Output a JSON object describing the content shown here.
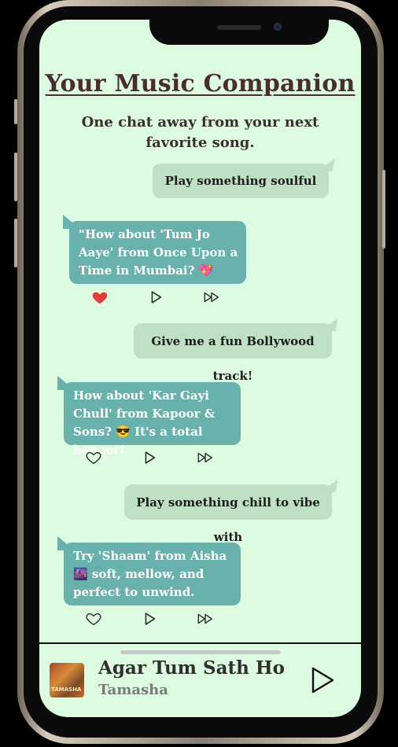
{
  "app": {
    "title": "Your Music Companion",
    "subtitle": "One chat away from your next favorite song."
  },
  "messages": [
    {
      "role": "user",
      "text": "Play something soulful"
    },
    {
      "role": "bot",
      "text": "\"How about 'Tum Jo Aaye' from Once Upon a Time in Mumbai? 💖",
      "liked": true
    },
    {
      "role": "user",
      "text": "Give me a fun Bollywood track!"
    },
    {
      "role": "bot",
      "text": "How about 'Kar Gayi Chull' from Kapoor & Sons? 😎 It's a total banger!",
      "liked": false
    },
    {
      "role": "user",
      "text": "Play something chill to vibe with"
    },
    {
      "role": "bot",
      "text": "Try 'Shaam' from Aisha 🌆 soft, mellow, and perfect to unwind.",
      "liked": false
    }
  ],
  "now_playing": {
    "title": "Agar Tum Sath Ho",
    "artist": "Tamasha"
  },
  "icons": {
    "like": "heart-icon",
    "play": "play-icon",
    "next": "fast-forward-icon"
  },
  "colors": {
    "background": "#ddfbe0",
    "user_bubble": "#bfe0c2",
    "bot_bubble": "#69b1ac",
    "heart_active": "#e43d3d"
  }
}
